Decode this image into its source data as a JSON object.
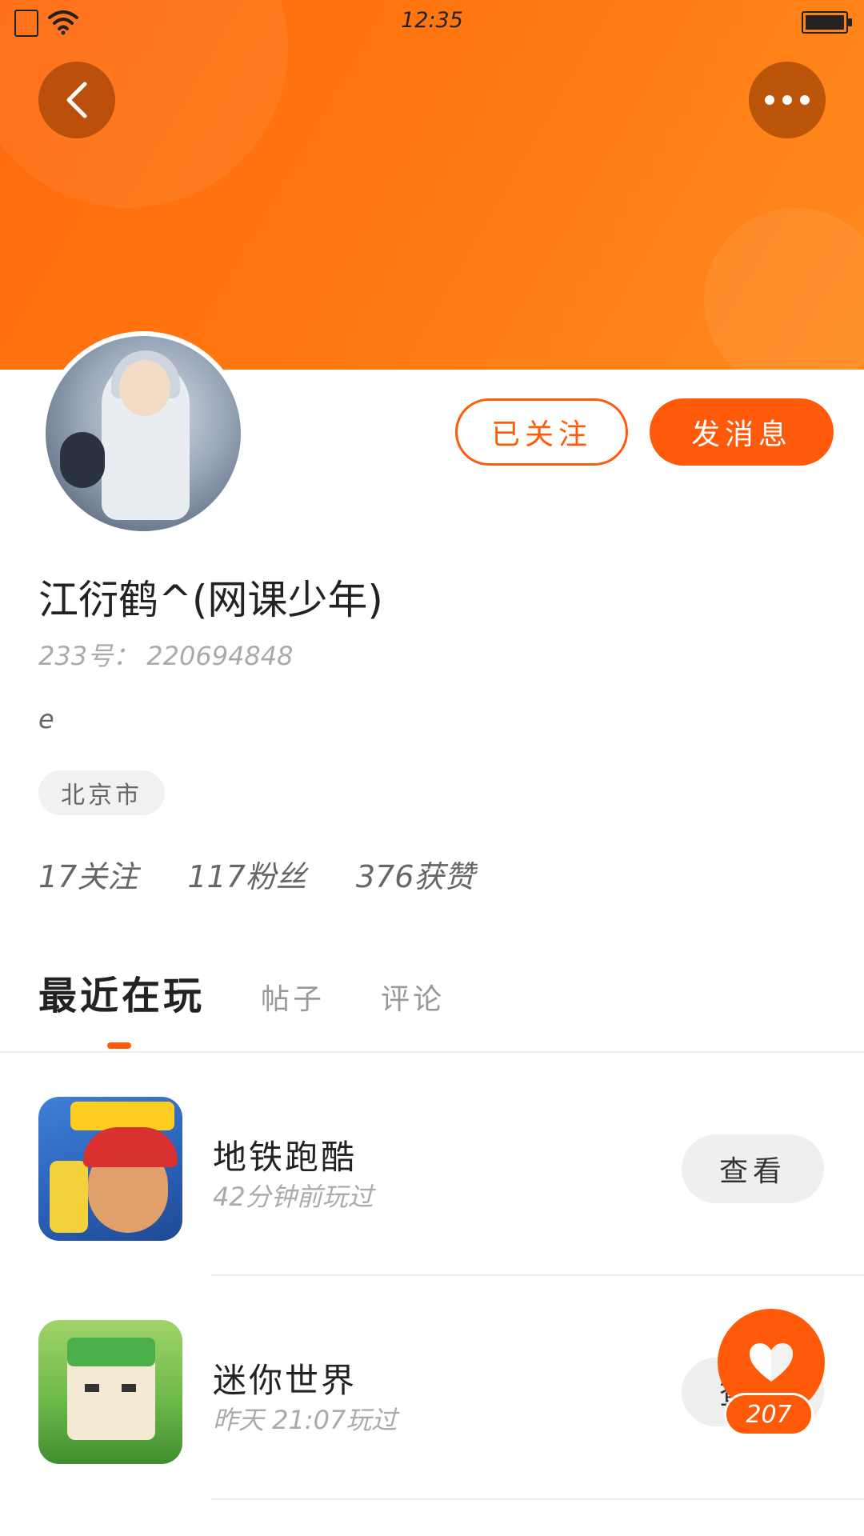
{
  "status_bar": {
    "time": "12:35"
  },
  "profile": {
    "name": "江衍鹤^(网课少年)",
    "id_label": "233号：",
    "id_value": "220694848",
    "bio": "e",
    "location": "北京市",
    "stats": {
      "following": "17关注",
      "followers": "117粉丝",
      "likes": "376获赞"
    }
  },
  "actions": {
    "follow": "已关注",
    "message": "发消息"
  },
  "tabs": [
    {
      "label": "最近在玩",
      "active": true
    },
    {
      "label": "帖子",
      "active": false
    },
    {
      "label": "评论",
      "active": false
    }
  ],
  "games": [
    {
      "name": "地铁跑酷",
      "time": "42分钟前玩过",
      "action": "查看"
    },
    {
      "name": "迷你世界",
      "time": "昨天 21:07玩过",
      "action": "查看"
    }
  ],
  "fab": {
    "count": "207"
  },
  "colors": {
    "accent": "#ff5a0a",
    "header_gradient_start": "#ff6a0d",
    "header_gradient_end": "#ff8a1e"
  },
  "icons": {
    "back": "back-arrow-icon",
    "more": "more-dots-icon",
    "heart": "heart-icon"
  }
}
